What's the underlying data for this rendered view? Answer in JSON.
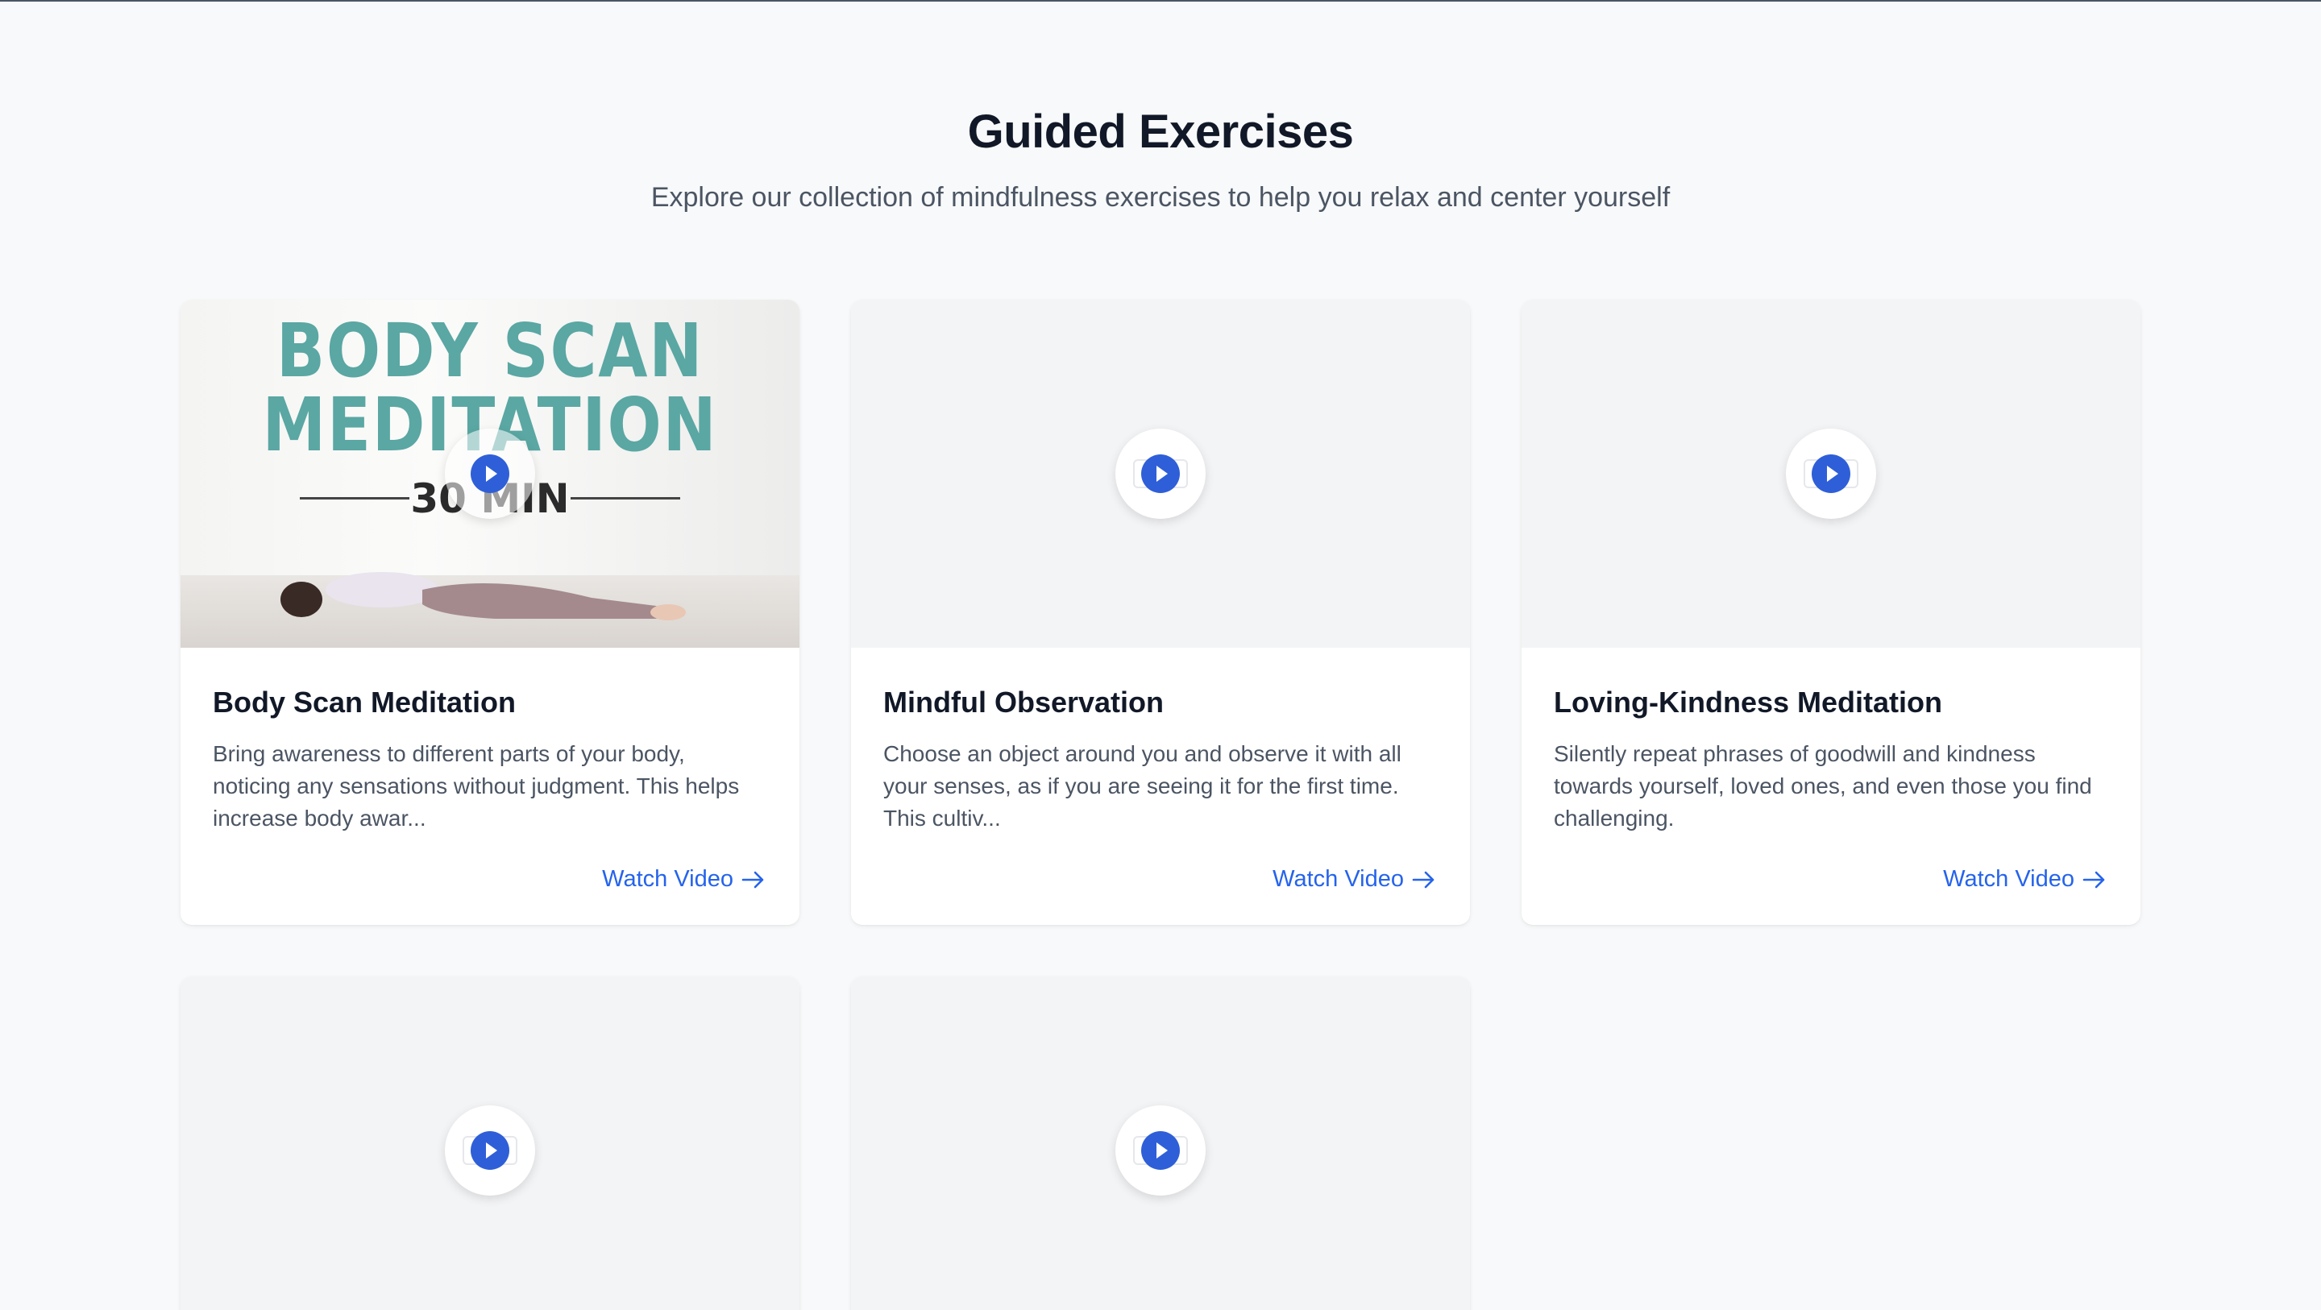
{
  "header": {
    "title": "Guided Exercises",
    "subtitle": "Explore our collection of mindfulness exercises to help you relax and center yourself"
  },
  "thumbnail_art": {
    "line1": "BODY SCAN",
    "line2": "MEDITATION",
    "duration": "30 MIN"
  },
  "cards": [
    {
      "title": "Body Scan Meditation",
      "description": "Bring awareness to different parts of your body, noticing any sensations without judgment. This helps increase body awar...",
      "link": "Watch Video"
    },
    {
      "title": "Mindful Observation",
      "description": "Choose an object around you and observe it with all your senses, as if you are seeing it for the first time. This cultiv...",
      "link": "Watch Video"
    },
    {
      "title": "Loving-Kindness Meditation",
      "description": "Silently repeat phrases of goodwill and kindness towards yourself, loved ones, and even those you find challenging.",
      "link": "Watch Video"
    }
  ],
  "colors": {
    "accent": "#2563eb",
    "play_button": "#2f5fd8",
    "background": "#f8f9fa"
  },
  "icons": {
    "play": "play-icon",
    "arrow": "arrow-right-icon"
  }
}
